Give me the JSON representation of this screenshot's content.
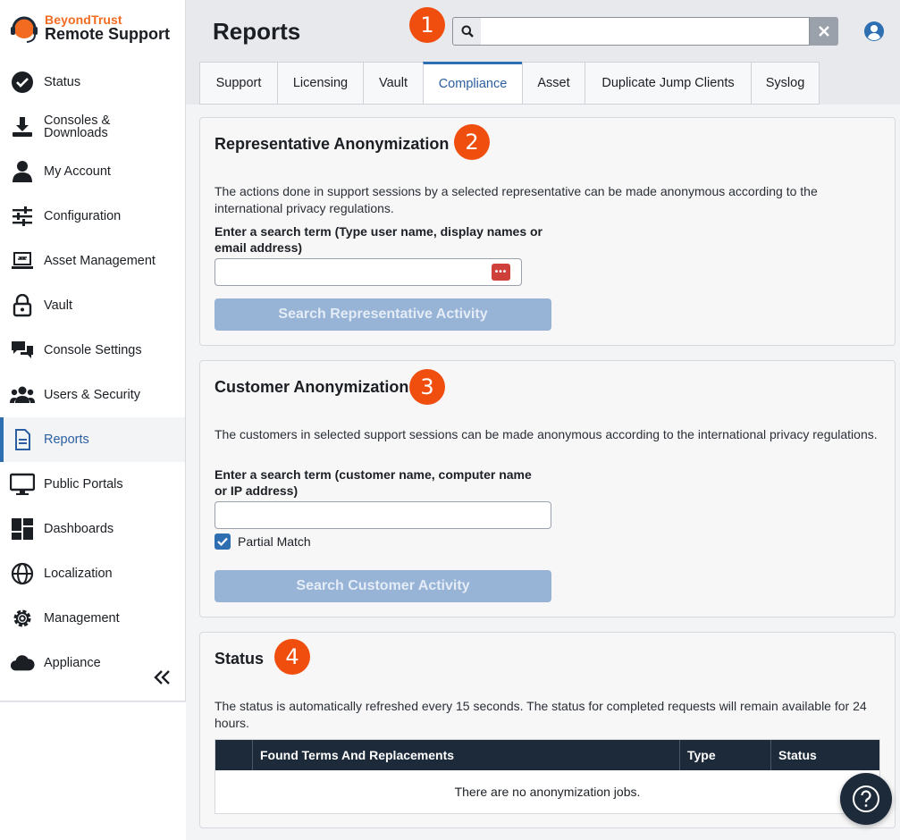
{
  "brand": {
    "name_top": "BeyondTrust",
    "name_bottom": "Remote Support",
    "accent_color": "#f26b21"
  },
  "sidebar": {
    "items": [
      {
        "label": "Status",
        "icon": "check-circle-icon"
      },
      {
        "label": "Consoles & Downloads",
        "icon": "download-icon"
      },
      {
        "label": "My Account",
        "icon": "person-icon"
      },
      {
        "label": "Configuration",
        "icon": "sliders-icon"
      },
      {
        "label": "Asset Management",
        "icon": "laptop-transfer-icon"
      },
      {
        "label": "Vault",
        "icon": "lock-icon"
      },
      {
        "label": "Console Settings",
        "icon": "chat-bubbles-icon"
      },
      {
        "label": "Users & Security",
        "icon": "users-icon"
      },
      {
        "label": "Reports",
        "icon": "document-icon",
        "active": true
      },
      {
        "label": "Public Portals",
        "icon": "monitor-icon"
      },
      {
        "label": "Dashboards",
        "icon": "dashboard-icon"
      },
      {
        "label": "Localization",
        "icon": "globe-icon"
      },
      {
        "label": "Management",
        "icon": "gear-icon"
      },
      {
        "label": "Appliance",
        "icon": "cloud-icon"
      }
    ],
    "collapse_icon": "double-chevron-left-icon"
  },
  "header": {
    "title": "Reports",
    "search_value": "",
    "markers": [
      "1",
      "2",
      "3",
      "4"
    ]
  },
  "tabs": [
    {
      "label": "Support"
    },
    {
      "label": "Licensing"
    },
    {
      "label": "Vault"
    },
    {
      "label": "Compliance",
      "active": true
    },
    {
      "label": "Asset"
    },
    {
      "label": "Duplicate Jump Clients"
    },
    {
      "label": "Syslog"
    }
  ],
  "rep_section": {
    "title": "Representative Anonymization",
    "description": "The actions done in support sessions by a selected representative can be made anonymous according to the international privacy regulations.",
    "field_label": "Enter a search term (Type user name, display names or email address)",
    "field_value": "",
    "button_label": "Search Representative Activity"
  },
  "customer_section": {
    "title": "Customer Anonymization",
    "description": "The customers in selected support sessions can be made anonymous according to the international privacy regulations.",
    "field_label": "Enter a search term (customer name, computer name or IP address)",
    "field_value": "",
    "checkbox_label": "Partial Match",
    "checkbox_checked": true,
    "button_label": "Search Customer Activity"
  },
  "status_section": {
    "title": "Status",
    "description": "The status is automatically refreshed every 15 seconds. The status for completed requests will remain available for 24 hours.",
    "columns": [
      "",
      "Found Terms And Replacements",
      "Type",
      "Status"
    ],
    "empty_message": "There are no anonymization jobs."
  }
}
